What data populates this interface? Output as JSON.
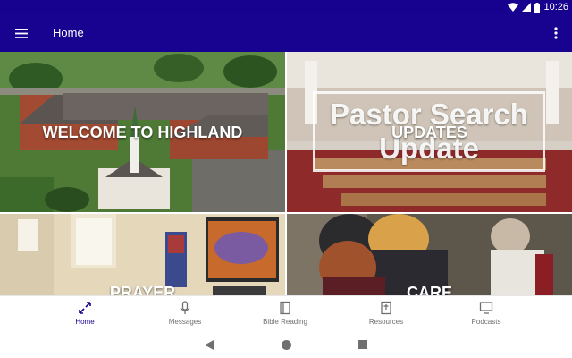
{
  "status_bar": {
    "time": "10:26",
    "icons": [
      "wifi-icon",
      "signal-icon",
      "battery-icon"
    ]
  },
  "app_bar": {
    "title": "Home",
    "menu_icon": "menu-icon",
    "overflow_icon": "more-vert-icon"
  },
  "tiles": [
    {
      "caption": "WELCOME TO HIGHLAND"
    },
    {
      "caption": "UPDATES",
      "overlay_line_1": "Pastor Search",
      "overlay_line_2": "Update"
    },
    {
      "caption": "PRAYER"
    },
    {
      "caption": "CARE"
    }
  ],
  "bottom_nav": {
    "items": [
      {
        "label": "Home",
        "icon": "home-icon",
        "active": true
      },
      {
        "label": "Messages",
        "icon": "microphone-icon",
        "active": false
      },
      {
        "label": "Bible Reading",
        "icon": "book-icon",
        "active": false
      },
      {
        "label": "Resources",
        "icon": "bible-icon",
        "active": false
      },
      {
        "label": "Podcasts",
        "icon": "monitor-icon",
        "active": false
      }
    ]
  },
  "system_nav": [
    "back-icon",
    "home-circle-icon",
    "recents-icon"
  ],
  "colors": {
    "primary": "#17038f",
    "nav_inactive": "#6f6f6f",
    "background": "#ffffff"
  }
}
